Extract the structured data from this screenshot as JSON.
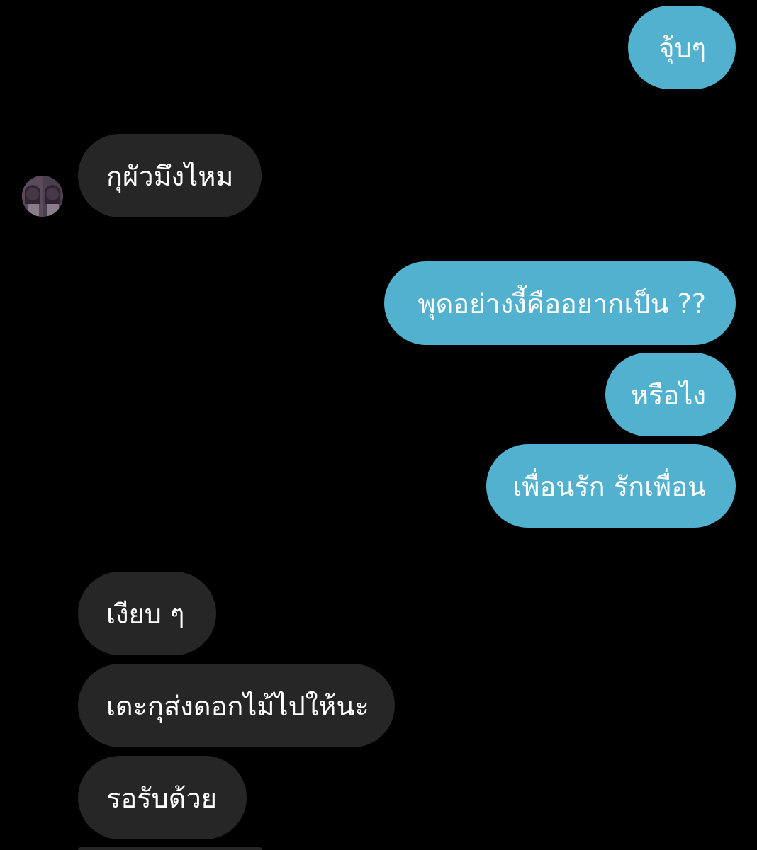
{
  "thread": {
    "messages": [
      {
        "side": "outgoing",
        "text": "จุ้บๆ"
      },
      {
        "side": "incoming",
        "text": "กุผัวมึงไหม"
      },
      {
        "side": "outgoing",
        "text": "พุดอย่างงี้คืออยากเป็น ??"
      },
      {
        "side": "outgoing",
        "text": "หรือไง"
      },
      {
        "side": "outgoing",
        "text": "เพื่อนรัก รักเพื่อน"
      },
      {
        "side": "incoming",
        "text": "เงียบ ๆ"
      },
      {
        "side": "incoming",
        "text": "เดะกุส่งดอกไม้ไปให้นะ"
      },
      {
        "side": "incoming",
        "text": "รอรับด้วย"
      }
    ]
  },
  "colors": {
    "background": "#000000",
    "outgoing_bubble": "#53b1d0",
    "incoming_bubble": "#262626",
    "text": "#ffffff"
  },
  "icons": {
    "contact_avatar": "avatar-icon"
  }
}
